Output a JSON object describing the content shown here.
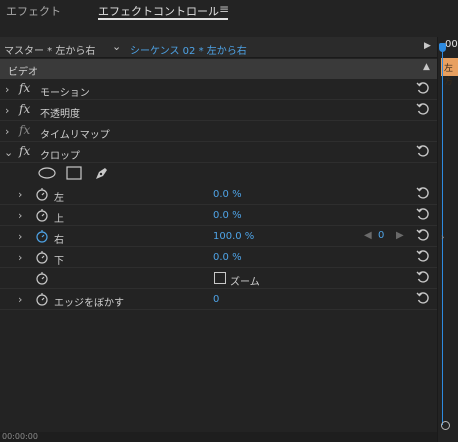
{
  "tabs": [
    {
      "label": "エフェクト",
      "active": false
    },
    {
      "label": "エフェクトコントロール",
      "active": true
    }
  ],
  "tab_menu_icon": "hamburger-menu-icon",
  "header": {
    "master": "マスター * 左から右",
    "sequence": "シーケンス 02 * 左から右"
  },
  "section": {
    "label": "ビデオ"
  },
  "effects": {
    "motion": "モーション",
    "opacity": "不透明度",
    "time_remap": "タイムリマップ",
    "crop": "クロップ"
  },
  "fx_label": "fx",
  "mask_tools": [
    "ellipse-mask-icon",
    "rectangle-mask-icon",
    "pen-mask-icon"
  ],
  "crop_params": [
    {
      "name": "左",
      "value": "0.0 %"
    },
    {
      "name": "上",
      "value": "0.0 %"
    },
    {
      "name": "右",
      "value": "100.0 %"
    },
    {
      "name": "下",
      "value": "0.0 %"
    }
  ],
  "keyframe_value": "0",
  "zoom": {
    "label": "ズーム",
    "checked": false
  },
  "feather": {
    "name": "エッジをぼかす",
    "value": "0"
  },
  "timeline": {
    "time": "00",
    "clip_label": "左方"
  },
  "bottom_time": "00:00:00",
  "colors": {
    "accent": "#4ea3e6",
    "playhead": "#2e8be0",
    "clip": "#e8a060"
  }
}
